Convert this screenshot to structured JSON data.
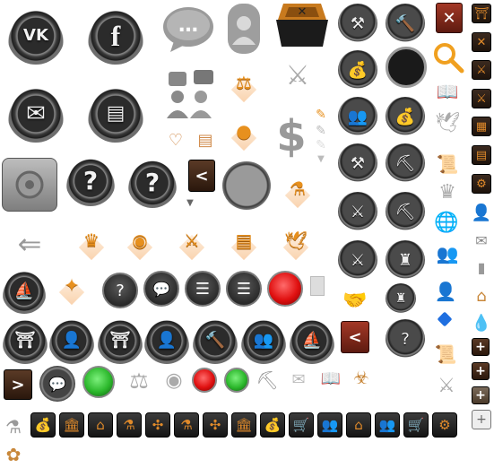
{
  "labels": {
    "vk": "VK",
    "facebook": "f",
    "chat": "…",
    "question": "?",
    "close": "✕",
    "back": "<",
    "forward": ">",
    "box_x": "✕",
    "dollar": "$",
    "plus": "+"
  },
  "colors": {
    "accent_orange": "#e7901e",
    "dark_button": "#2b2b2b",
    "red_button": "#e01010",
    "green_button": "#2cb82c",
    "close_red": "#a33826",
    "blue_gem": "#1f6fe0"
  },
  "icons": [
    "vk-icon",
    "facebook-icon",
    "chat-bubble-icon",
    "profile-icon",
    "crate-icon",
    "compass-icon",
    "hammer-icon",
    "close-icon",
    "gate-icon",
    "envelope-icon",
    "scroll-icon",
    "people-icon",
    "scales-icon",
    "viking-helmet-icon",
    "question-icon",
    "sack-icon",
    "dove-icon",
    "crown-icon",
    "crossed-swords-icon",
    "flask-icon",
    "ship-icon",
    "tower-icon",
    "barracks-icon",
    "shovel-icon",
    "globe-icon",
    "book-icon",
    "search-icon",
    "lock-safe-icon",
    "heart-monitor-icon",
    "biohazard-icon",
    "windmill-icon",
    "pickaxe-icon",
    "wheat-icon",
    "cart-icon",
    "house-icon",
    "gear-icon",
    "bank-icon",
    "coins-icon",
    "drop-icon",
    "plus-icon",
    "back-arrow-icon",
    "menu-icon"
  ]
}
